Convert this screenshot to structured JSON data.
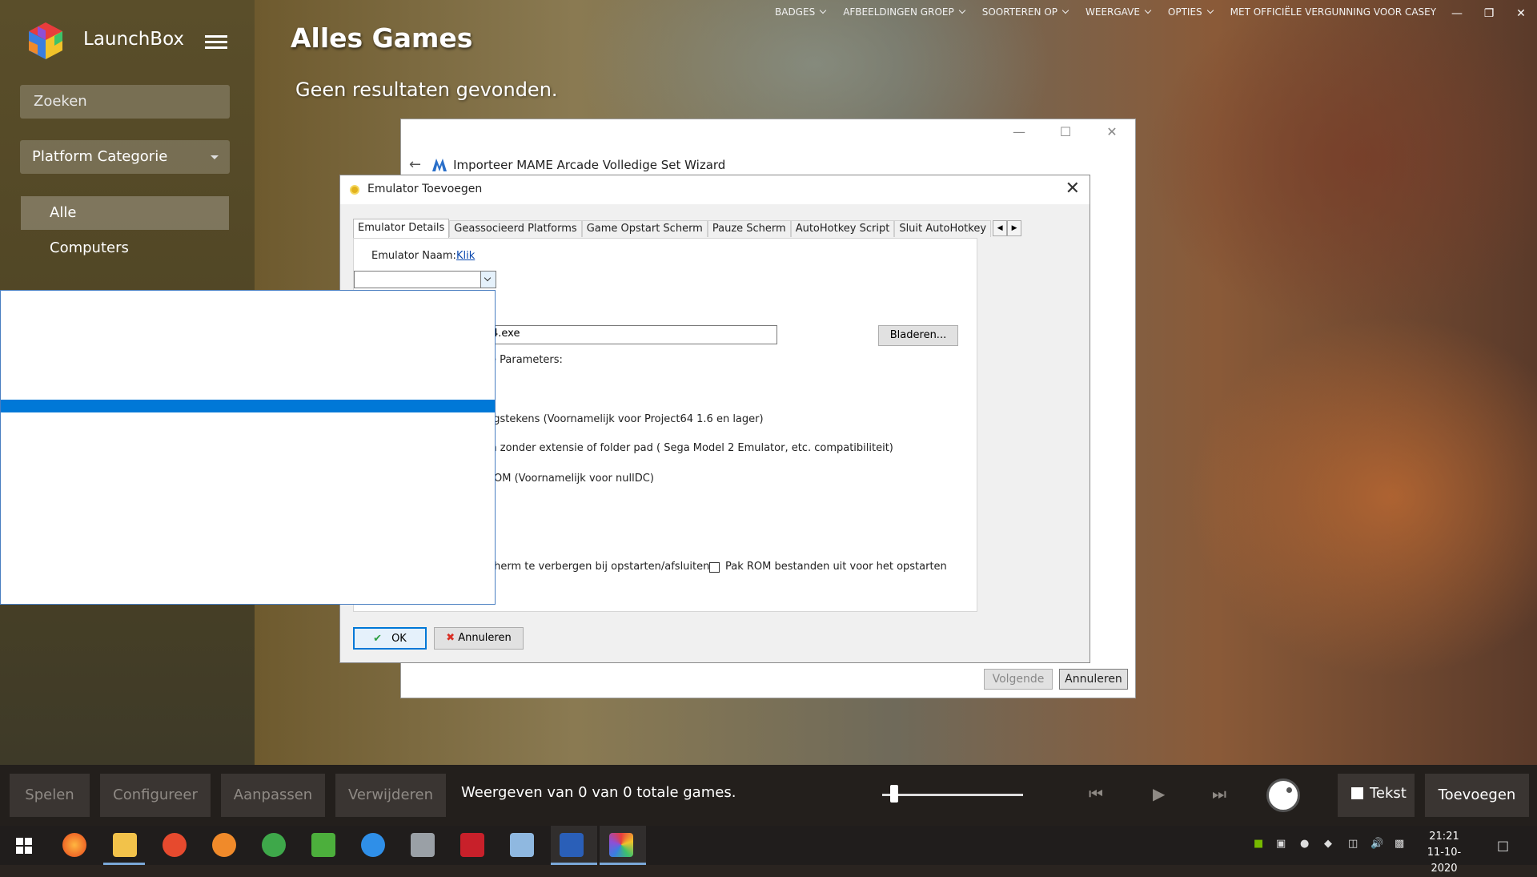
{
  "app": {
    "name": "LaunchBox"
  },
  "sidebar": {
    "search_placeholder": "Zoeken",
    "platform_category": "Platform Categorie",
    "items": [
      {
        "label": "Alle",
        "active": true
      },
      {
        "label": "Computers",
        "active": false
      }
    ]
  },
  "main": {
    "title": "Alles Games",
    "no_results": "Geen resultaten gevonden."
  },
  "top_menu": [
    {
      "label": "BADGES"
    },
    {
      "label": "AFBEELDINGEN GROEP"
    },
    {
      "label": "SOORTEREN OP"
    },
    {
      "label": "WEERGAVE"
    },
    {
      "label": "OPTIES"
    },
    {
      "label": "MET OFFICIËLE VERGUNNING VOOR CASEY"
    }
  ],
  "wizard": {
    "title": "Importeer MAME Arcade Volledige Set Wizard",
    "next_label": "Volgende",
    "cancel_label": "Annuleren"
  },
  "dialog": {
    "title": "Emulator Toevoegen",
    "tabs": [
      "Emulator Details",
      "Geassocieerd Platforms",
      "Game Opstart Scherm",
      "Pauze Scherm",
      "AutoHotkey Script",
      "Sluit AutoHotkey"
    ],
    "emulator_name_label": "Emulator Naam:",
    "emulator_name_link": "Klik",
    "path_value": "4.exe",
    "browse_label": "Bladeren...",
    "params_label": "e Parameters:",
    "option1": "ngstekens (Voornamelijk voor Project64 1.6 en lager)",
    "option2": "m zonder extensie of folder pad ( Sega Model 2 Emulator, etc. compatibiliteit)",
    "option3": "ROM (Voornamelijk voor nullDC)",
    "option4": "cherm te verbergen bij opstarten/afsluiten",
    "option5": "Pak ROM bestanden uit voor het opstarten",
    "ok_label": "OK",
    "cancel_label": "Annuleren"
  },
  "bottombar": {
    "play": "Spelen",
    "configure": "Configureer",
    "edit": "Aanpassen",
    "delete": "Verwijderen",
    "status": "Weergeven van 0 van 0 totale games.",
    "text_label": "Tekst",
    "add_label": "Toevoegen"
  },
  "taskbar": {
    "time": "21:21",
    "date": "11-10-2020"
  },
  "colors": {
    "accent": "#0078d7",
    "bottombar": "#231f1c",
    "sidebar": "#4e4424"
  }
}
